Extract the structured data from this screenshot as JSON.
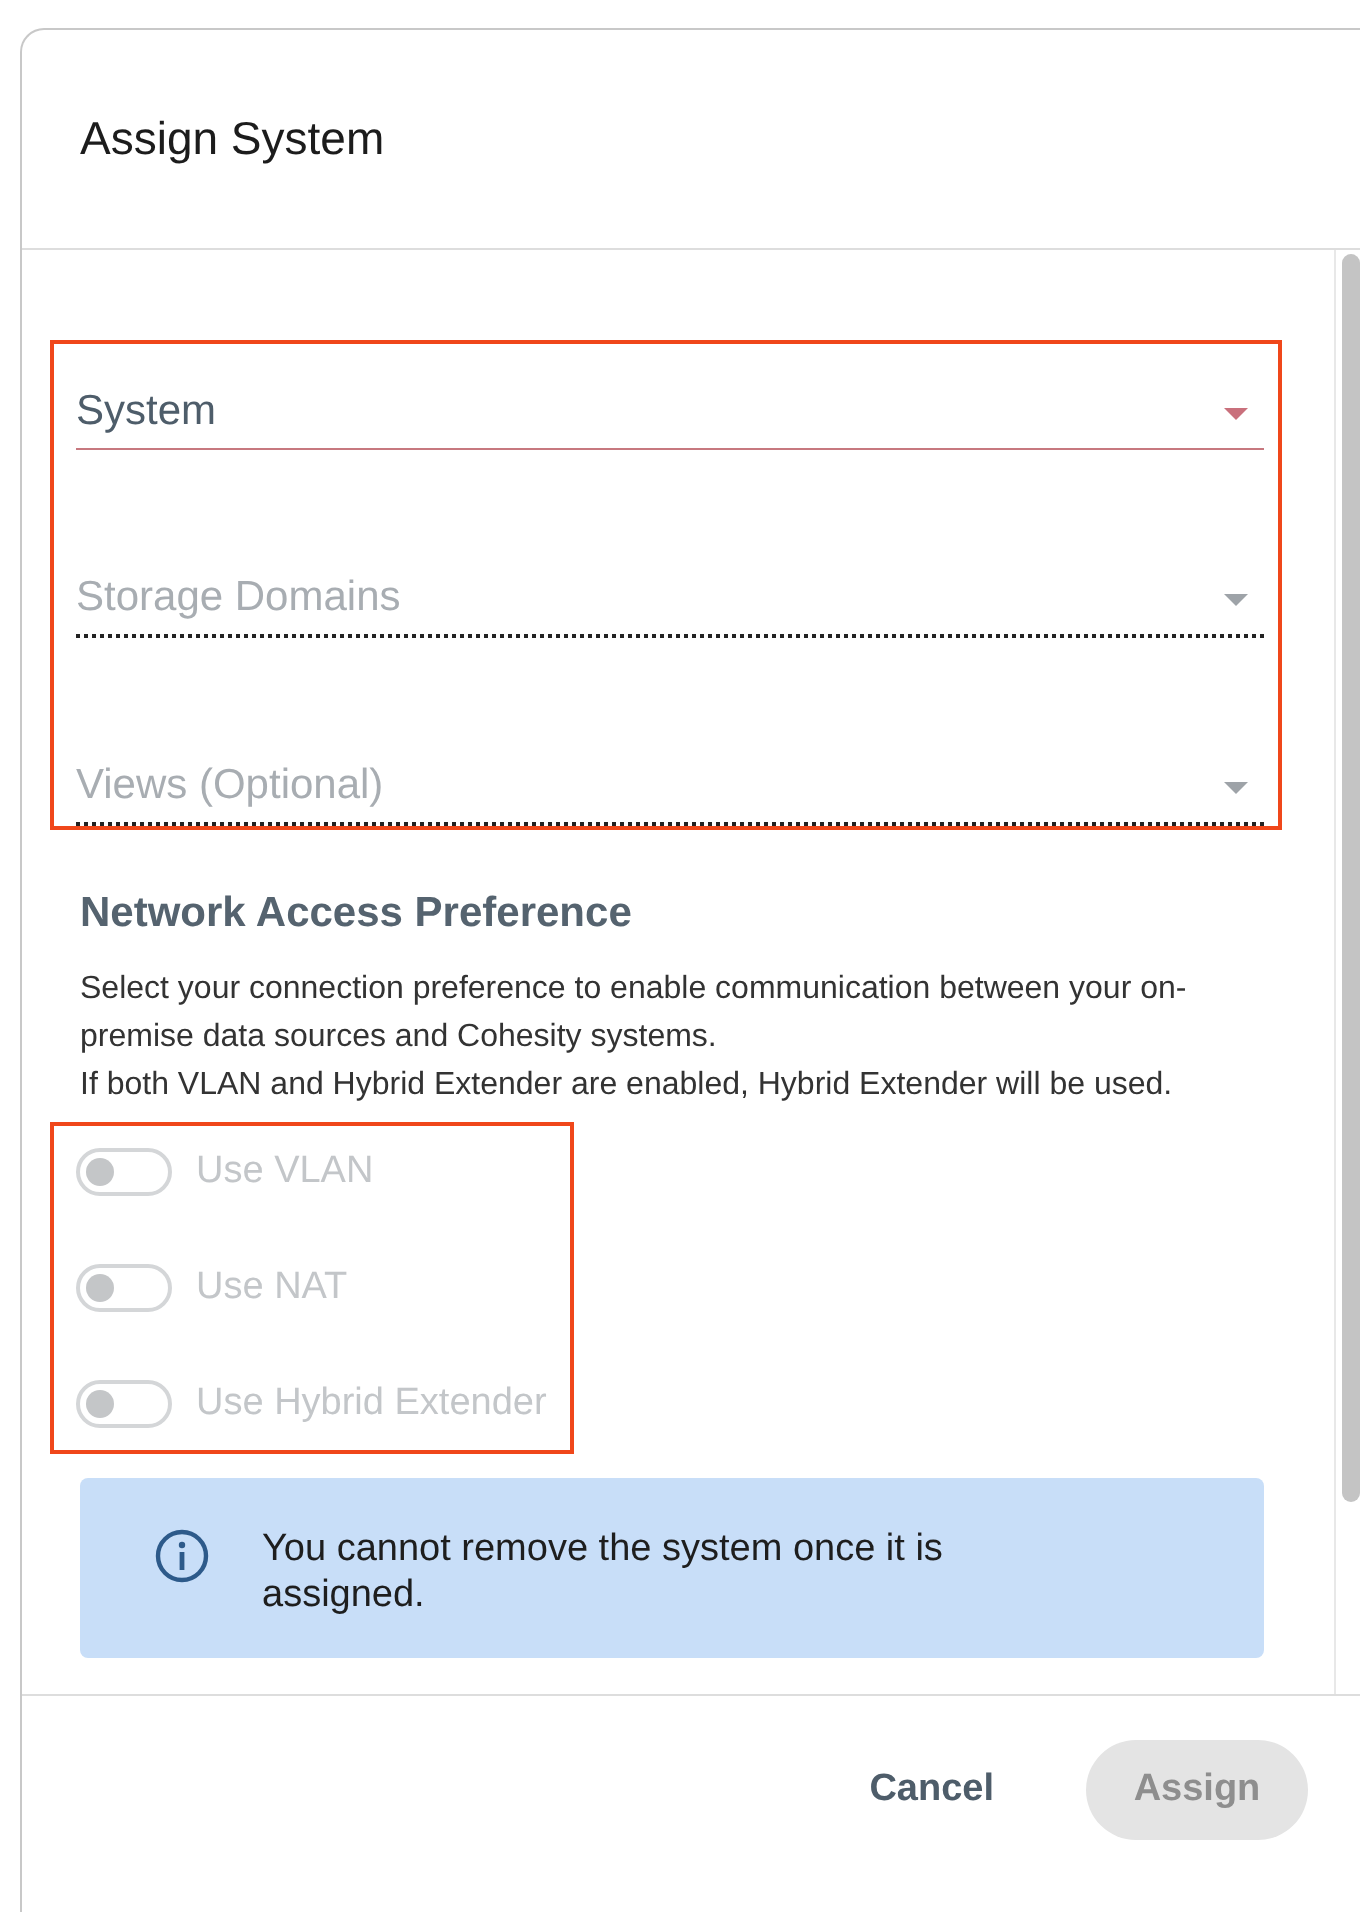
{
  "dialog": {
    "title": "Assign System"
  },
  "fields": [
    {
      "label": "System",
      "invalid": true,
      "disabled": false
    },
    {
      "label": "Storage Domains",
      "invalid": false,
      "disabled": true
    },
    {
      "label": "Views (Optional)",
      "invalid": false,
      "disabled": true
    }
  ],
  "network": {
    "heading": "Network Access Preference",
    "description": [
      "Select your connection preference to enable communication between your on-premise data sources and Cohesity systems.",
      "If both VLAN and Hybrid Extender are enabled, Hybrid Extender will be used."
    ]
  },
  "toggles": [
    {
      "label": "Use VLAN",
      "on": false,
      "disabled": true
    },
    {
      "label": "Use NAT",
      "on": false,
      "disabled": true
    },
    {
      "label": "Use Hybrid Extender",
      "on": false,
      "disabled": true
    }
  ],
  "info": {
    "text": "You cannot remove the system once it is assigned."
  },
  "buttons": [
    {
      "label": "Cancel",
      "kind": "text",
      "disabled": false
    },
    {
      "label": "Assign",
      "kind": "primary",
      "disabled": true
    }
  ]
}
